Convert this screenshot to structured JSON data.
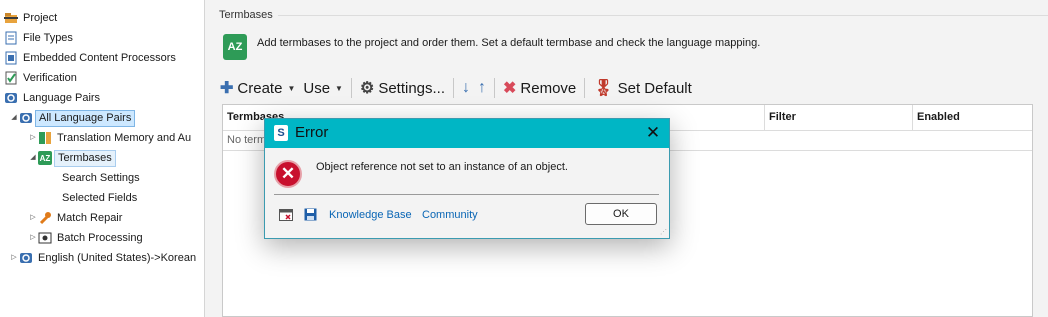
{
  "sidebar": {
    "items": [
      {
        "label": "Project",
        "icon": "project-icon"
      },
      {
        "label": "File Types",
        "icon": "file-types-icon"
      },
      {
        "label": "Embedded Content Processors",
        "icon": "embedded-content-icon"
      },
      {
        "label": "Verification",
        "icon": "verification-icon"
      },
      {
        "label": "Language Pairs",
        "icon": "language-pairs-icon"
      },
      {
        "label": "All Language Pairs",
        "icon": "language-pairs-icon",
        "expander": "◢"
      },
      {
        "label": "Translation Memory and Au",
        "icon": "translation-memory-icon",
        "expander": "▷"
      },
      {
        "label": "Termbases",
        "icon": "termbase-icon",
        "expander": "◢"
      },
      {
        "label": "Search Settings",
        "icon": ""
      },
      {
        "label": "Selected Fields",
        "icon": ""
      },
      {
        "label": "Match Repair",
        "icon": "wrench-icon",
        "expander": "▷"
      },
      {
        "label": "Batch Processing",
        "icon": "batch-processing-icon",
        "expander": "▷"
      },
      {
        "label": "English (United States)->Korean",
        "icon": "language-pairs-icon",
        "expander": "▷"
      }
    ]
  },
  "main": {
    "group_title": "Termbases",
    "badge_text": "AZ",
    "description": "Add termbases to the project and order them. Set a default termbase and check the language mapping.",
    "toolbar": {
      "create_label": "Create",
      "use_label": "Use",
      "settings_label": "Settings...",
      "remove_label": "Remove",
      "set_default_label": "Set Default"
    },
    "grid": {
      "columns": [
        "Termbases",
        "Filter",
        "Enabled"
      ],
      "empty_text": "No termbases"
    }
  },
  "dialog": {
    "title": "Error",
    "logo_letter": "S",
    "close_glyph": "✕",
    "error_glyph": "✕",
    "message": "Object reference not set to an instance of an object.",
    "knowledge_base_label": "Knowledge Base",
    "community_label": "Community",
    "ok_label": "OK"
  },
  "colors": {
    "dialog_title_bar": "#00b6c5",
    "link": "#0a66b5",
    "error_red": "#c8102e",
    "selection": "#cde8ff"
  }
}
